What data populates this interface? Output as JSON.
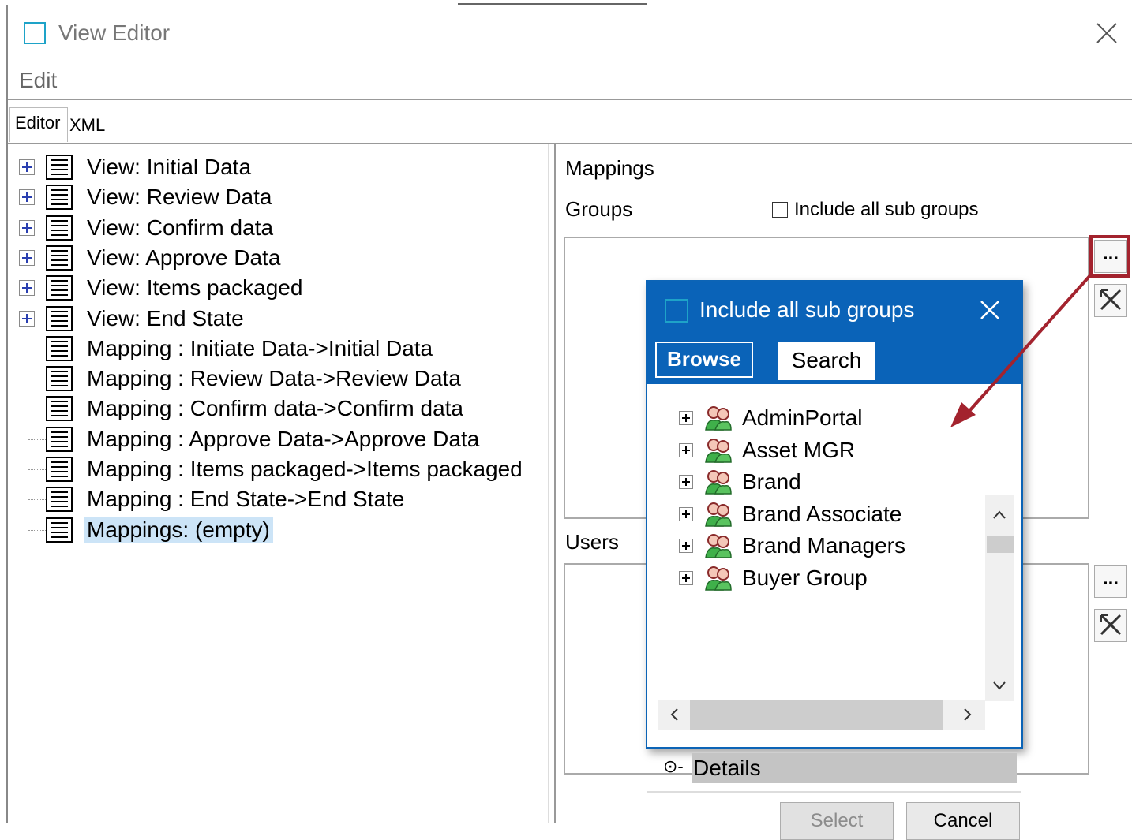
{
  "window": {
    "title": "View Editor"
  },
  "menu": {
    "edit": "Edit"
  },
  "tabs": {
    "editor": "Editor",
    "xml": "XML"
  },
  "tree": [
    {
      "label": "View: Initial Data",
      "expandable": true
    },
    {
      "label": "View: Review Data",
      "expandable": true
    },
    {
      "label": "View: Confirm data",
      "expandable": true
    },
    {
      "label": "View: Approve Data",
      "expandable": true
    },
    {
      "label": "View: Items packaged",
      "expandable": true
    },
    {
      "label": "View: End State",
      "expandable": true
    },
    {
      "label": "Mapping : Initiate Data->Initial Data",
      "expandable": false
    },
    {
      "label": "Mapping : Review Data->Review Data",
      "expandable": false
    },
    {
      "label": "Mapping : Confirm data->Confirm data",
      "expandable": false
    },
    {
      "label": "Mapping : Approve Data->Approve Data",
      "expandable": false
    },
    {
      "label": "Mapping : Items packaged->Items packaged",
      "expandable": false
    },
    {
      "label": "Mapping : End State->End State",
      "expandable": false
    },
    {
      "label": "Mappings: (empty)",
      "expandable": false,
      "selected": true
    }
  ],
  "mappings": {
    "heading": "Mappings",
    "groups_label": "Groups",
    "include_sub_groups": "Include all sub groups",
    "users_label": "Users",
    "browse_button": "...",
    "remove_icon": "remove-icon"
  },
  "dialog": {
    "title": "Include all sub groups",
    "tab_browse": "Browse",
    "tab_search": "Search",
    "groups": [
      "AdminPortal",
      "Asset MGR",
      "Brand",
      "Brand Associate",
      "Brand Managers",
      "Buyer Group"
    ],
    "details": "Details",
    "select": "Select",
    "cancel": "Cancel"
  },
  "colors": {
    "accent": "#0a63b8",
    "highlight": "#a3232e",
    "selection": "#cce4f7"
  }
}
